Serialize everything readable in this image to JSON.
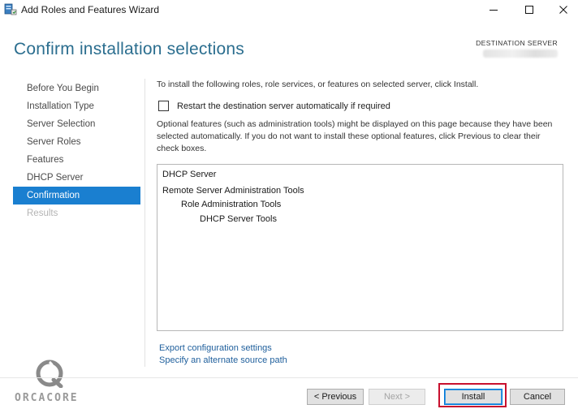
{
  "window": {
    "title": "Add Roles and Features Wizard",
    "icon": "server-manager-icon"
  },
  "header": {
    "page_title": "Confirm installation selections",
    "destination_label": "DESTINATION SERVER"
  },
  "nav": {
    "items": [
      {
        "label": "Before You Begin",
        "state": "normal"
      },
      {
        "label": "Installation Type",
        "state": "normal"
      },
      {
        "label": "Server Selection",
        "state": "normal"
      },
      {
        "label": "Server Roles",
        "state": "normal"
      },
      {
        "label": "Features",
        "state": "normal"
      },
      {
        "label": "DHCP Server",
        "state": "normal"
      },
      {
        "label": "Confirmation",
        "state": "active"
      },
      {
        "label": "Results",
        "state": "disabled"
      }
    ]
  },
  "content": {
    "intro": "To install the following roles, role services, or features on selected server, click Install.",
    "restart_checkbox_label": "Restart the destination server automatically if required",
    "restart_checked": false,
    "optional_note": "Optional features (such as administration tools) might be displayed on this page because they have been selected automatically. If you do not want to install these optional features, click Previous to clear their check boxes.",
    "selections": [
      {
        "label": "DHCP Server",
        "level": 0
      },
      {
        "label": "Remote Server Administration Tools",
        "level": 0
      },
      {
        "label": "Role Administration Tools",
        "level": 1
      },
      {
        "label": "DHCP Server Tools",
        "level": 2
      }
    ],
    "links": {
      "export": "Export configuration settings",
      "alternate_source": "Specify an alternate source path"
    }
  },
  "branding": {
    "logo_text": "ORCACORE"
  },
  "footer": {
    "previous_label": "< Previous",
    "next_label": "Next >",
    "install_label": "Install",
    "cancel_label": "Cancel"
  },
  "colors": {
    "title_blue": "#2b6e8f",
    "active_nav": "#1a7fd0",
    "link_blue": "#1f5f9c",
    "highlight_red": "#c8102e"
  }
}
